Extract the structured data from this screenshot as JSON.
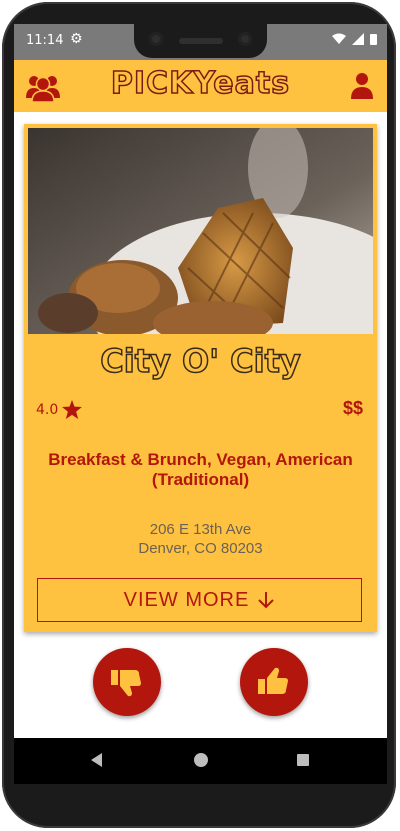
{
  "status_bar": {
    "time": "11:14"
  },
  "app_bar": {
    "logo": "PICKYeats"
  },
  "restaurant": {
    "name": "City O' City",
    "rating": "4.0",
    "price": "$$",
    "categories": "Breakfast & Brunch, Vegan, American (Traditional)",
    "address_line1": "206 E 13th Ave",
    "address_line2": "Denver, CO 80203"
  },
  "actions": {
    "view_more_label": "VIEW MORE"
  },
  "colors": {
    "accent": "#fec240",
    "brand_red": "#b3160d",
    "status_bar": "#7a7a7a"
  },
  "icons": {
    "app_bar_left": "group-icon",
    "app_bar_right": "user-icon",
    "rating": "star-icon",
    "view_more": "arrow-down-icon",
    "dislike": "thumbs-down-icon",
    "like": "thumbs-up-icon"
  }
}
